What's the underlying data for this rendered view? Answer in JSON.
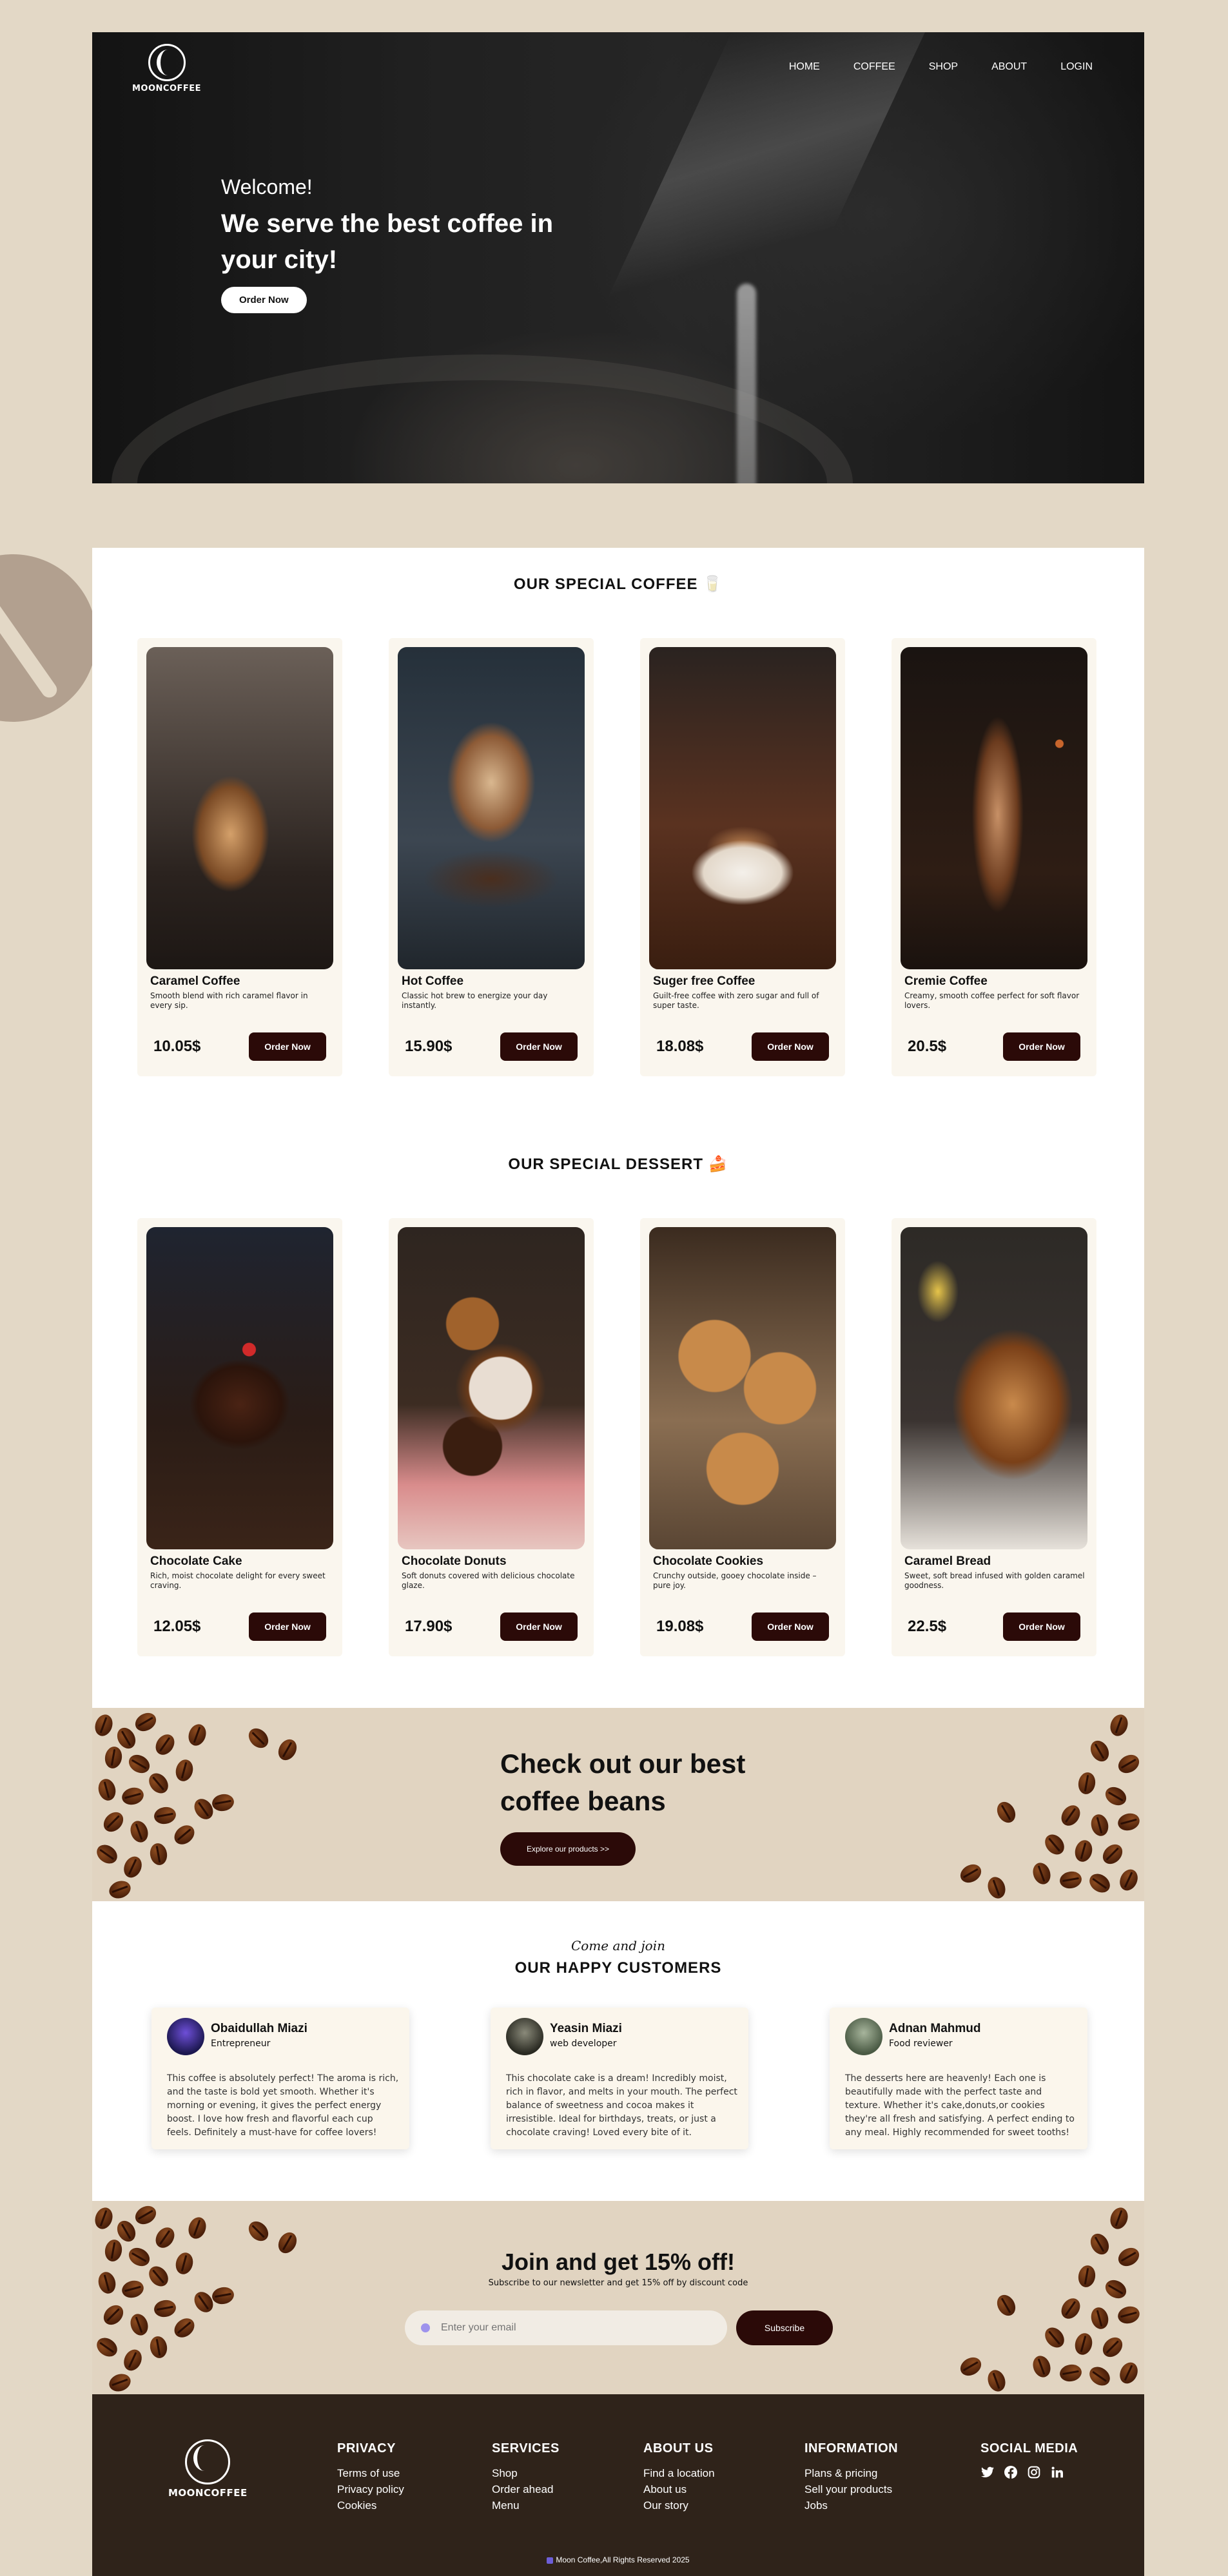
{
  "brand": {
    "logo_text": "MOONCOFFEE"
  },
  "nav": [
    "HOME",
    "COFFEE",
    "SHOP",
    "ABOUT",
    "LOGIN"
  ],
  "hero": {
    "welcome": "Welcome!",
    "headline": "We serve the best coffee in your city!",
    "cta": "Order Now"
  },
  "coffee_section": {
    "title": "OUR SPECIAL COFFEE 🥛",
    "items": [
      {
        "name": "Caramel Coffee",
        "desc": "Smooth blend with rich caramel flavor in every sip.",
        "price": "10.05$",
        "button": "Order Now"
      },
      {
        "name": "Hot Coffee",
        "desc": "Classic hot brew to energize your day instantly.",
        "price": "15.90$",
        "button": "Order Now"
      },
      {
        "name": "Suger free Coffee",
        "desc": "Guilt-free coffee with zero sugar and full of super taste.",
        "price": "18.08$",
        "button": "Order Now"
      },
      {
        "name": "Cremie Coffee",
        "desc": "Creamy, smooth coffee perfect for soft flavor lovers.",
        "price": "20.5$",
        "button": "Order Now"
      }
    ]
  },
  "dessert_section": {
    "title": "OUR SPECIAL DESSERT 🍰",
    "items": [
      {
        "name": "Chocolate Cake",
        "desc": "Rich, moist chocolate delight for every sweet craving.",
        "price": "12.05$",
        "button": "Order Now"
      },
      {
        "name": "Chocolate Donuts",
        "desc": "Soft donuts covered with delicious chocolate glaze.",
        "price": "17.90$",
        "button": "Order Now"
      },
      {
        "name": "Chocolate Cookies",
        "desc": "Crunchy outside, gooey chocolate inside – pure joy.",
        "price": "19.08$",
        "button": "Order Now"
      },
      {
        "name": "Caramel Bread",
        "desc": "Sweet, soft bread infused with golden caramel goodness.",
        "price": "22.5$",
        "button": "Order Now"
      }
    ]
  },
  "beans_banner": {
    "headline": "Check out our best coffee beans",
    "cta": "Explore our products >>"
  },
  "testimonials": {
    "script": "Come and join",
    "title": "OUR HAPPY CUSTOMERS",
    "items": [
      {
        "name": "Obaidullah Miazi",
        "role": "Entrepreneur",
        "text": "This coffee is absolutely perfect! The aroma is rich, and the taste is bold yet smooth. Whether it's morning or evening, it gives the perfect energy boost. I love how fresh and flavorful each cup feels. Definitely a must-have for coffee lovers!"
      },
      {
        "name": "Yeasin Miazi",
        "role": "web developer",
        "text": "This chocolate cake is a dream! Incredibly moist, rich in flavor, and melts in your mouth. The perfect balance of sweetness and cocoa makes it irresistible. Ideal for birthdays, treats, or just a chocolate craving! Loved every bite of it."
      },
      {
        "name": "Adnan Mahmud",
        "role": "Food reviewer",
        "text": "The desserts here are heavenly! Each one is beautifully made with the perfect taste and texture. Whether it's cake,donuts,or cookies they're all fresh and satisfying. A perfect ending to any meal. Highly recommended for sweet tooths!"
      }
    ]
  },
  "promo": {
    "headline": "Join and get 15% off!",
    "sub": "Subscribe to our newsletter and get 15% off by discount code",
    "placeholder": "Enter your email",
    "button": "Subscribe"
  },
  "footer": {
    "columns": [
      {
        "title": "PRIVACY",
        "links": [
          "Terms of use",
          "Privacy policy",
          "Cookies"
        ]
      },
      {
        "title": "SERVICES",
        "links": [
          "Shop",
          "Order ahead",
          "Menu"
        ]
      },
      {
        "title": "ABOUT US",
        "links": [
          "Find a location",
          "About us",
          "Our story"
        ]
      },
      {
        "title": "INFORMATION",
        "links": [
          "Plans & pricing",
          "Sell your products",
          "Jobs"
        ]
      }
    ],
    "social_title": "SOCIAL MEDIA",
    "social_icons": [
      "twitter-icon",
      "facebook-icon",
      "instagram-icon",
      "linkedin-icon"
    ],
    "copyright": "Moon Coffee,All Rights Reserved 2025"
  },
  "colors": {
    "page_bg": "#e3d8c6",
    "accent_dark": "#2b0a08",
    "footer_bg": "#2f231a",
    "card_bg": "#faf6ee"
  }
}
